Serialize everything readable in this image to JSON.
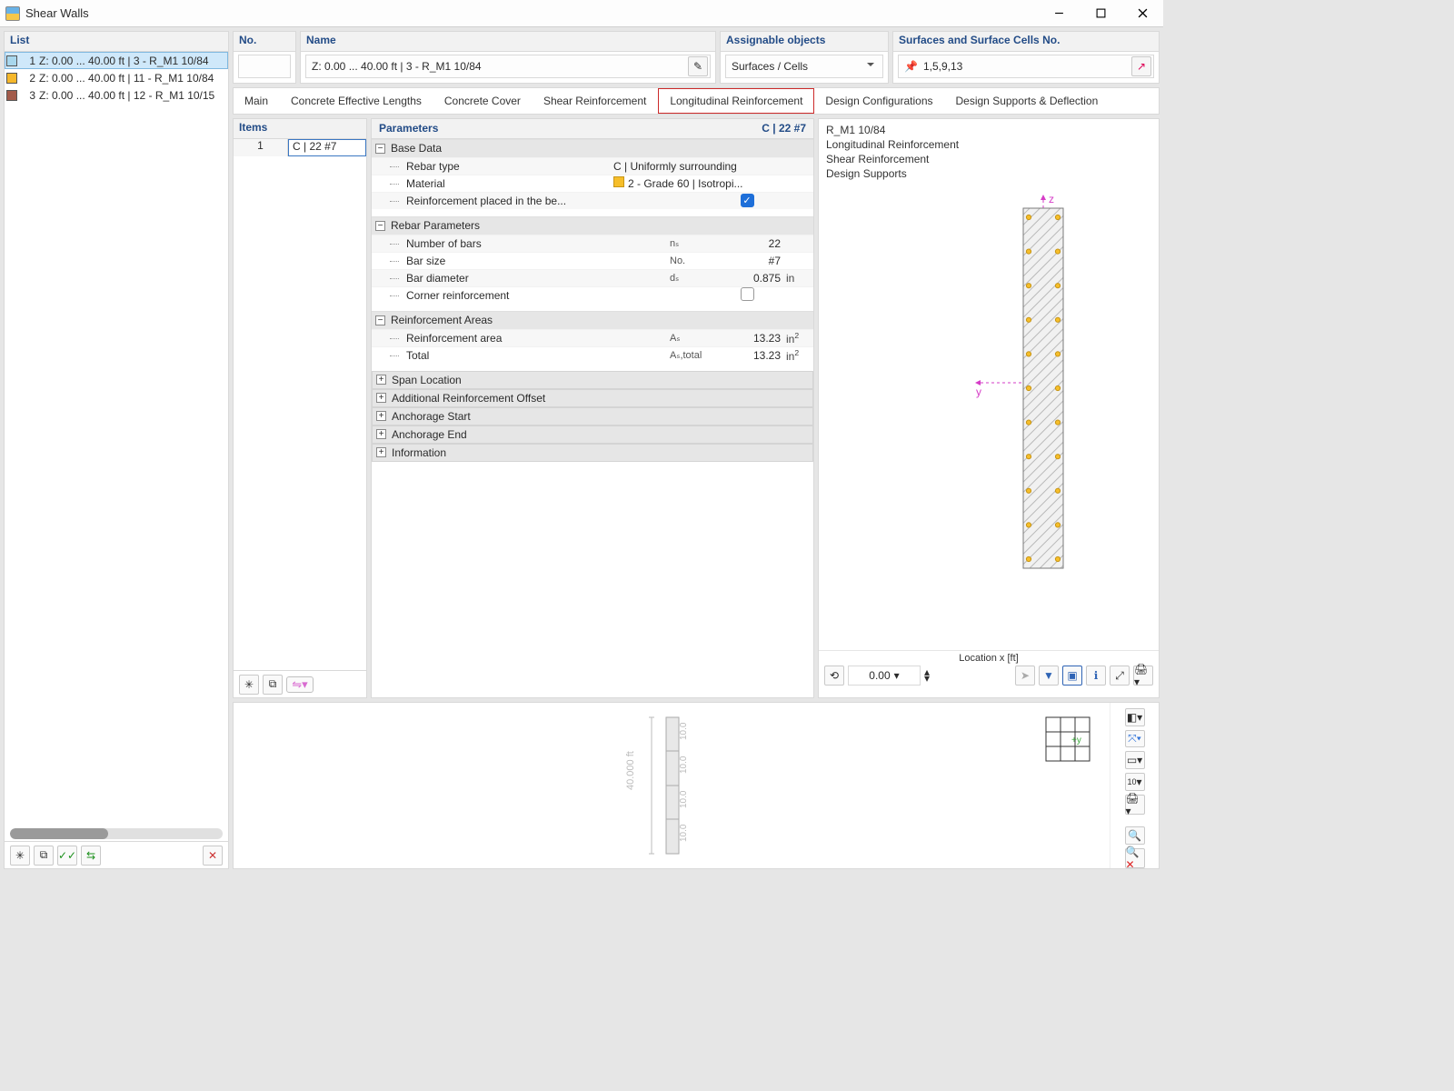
{
  "window": {
    "title": "Shear Walls"
  },
  "sidebar": {
    "header": "List",
    "items": [
      {
        "n": "1",
        "swatch": "#a8d7ed",
        "text": "Z: 0.00 ... 40.00 ft | 3 - R_M1 10/84",
        "selected": true
      },
      {
        "n": "2",
        "swatch": "#f5b72b",
        "text": "Z: 0.00 ... 40.00 ft | 11 - R_M1 10/84",
        "selected": false
      },
      {
        "n": "3",
        "swatch": "#a35b4a",
        "text": "Z: 0.00 ... 40.00 ft | 12 - R_M1 10/15",
        "selected": false
      }
    ]
  },
  "top": {
    "no_label": "No.",
    "no_value": "",
    "name_label": "Name",
    "name_value": "Z: 0.00 ... 40.00  ft | 3 - R_M1 10/84",
    "assign_label": "Assignable objects",
    "assign_value": "Surfaces / Cells",
    "surf_label": "Surfaces and Surface Cells No.",
    "surf_value": "1,5,9,13"
  },
  "tabs": [
    {
      "label": "Main",
      "active": false
    },
    {
      "label": "Concrete Effective Lengths",
      "active": false
    },
    {
      "label": "Concrete Cover",
      "active": false
    },
    {
      "label": "Shear Reinforcement",
      "active": false
    },
    {
      "label": "Longitudinal Reinforcement",
      "active": true
    },
    {
      "label": "Design Configurations",
      "active": false
    },
    {
      "label": "Design Supports & Deflection",
      "active": false
    }
  ],
  "items": {
    "header": "Items",
    "rows": [
      {
        "n": "1",
        "val": "C | 22 #7"
      }
    ]
  },
  "params": {
    "header": "Parameters",
    "header_right": "C | 22 #7",
    "groups": [
      {
        "title": "Base Data",
        "open": true,
        "rows": [
          {
            "label": "Rebar type",
            "sym": "",
            "val": "C | Uniformly surrounding",
            "unit": "",
            "mode": "text"
          },
          {
            "label": "Material",
            "sym": "",
            "val": "2 - Grade 60 | Isotropi...",
            "unit": "",
            "mode": "swatch"
          },
          {
            "label": "Reinforcement placed in the be...",
            "sym": "",
            "val": "",
            "unit": "",
            "mode": "checked"
          }
        ]
      },
      {
        "title": "Rebar Parameters",
        "open": true,
        "rows": [
          {
            "label": "Number of bars",
            "sym": "nₛ",
            "val": "22",
            "unit": ""
          },
          {
            "label": "Bar size",
            "sym": "No.",
            "val": "#7",
            "unit": ""
          },
          {
            "label": "Bar diameter",
            "sym": "dₛ",
            "val": "0.875",
            "unit": "in"
          },
          {
            "label": "Corner reinforcement",
            "sym": "",
            "val": "",
            "unit": "",
            "mode": "unchecked"
          }
        ]
      },
      {
        "title": "Reinforcement Areas",
        "open": true,
        "rows": [
          {
            "label": "Reinforcement area",
            "sym": "Aₛ",
            "val": "13.23",
            "unit": "in²"
          },
          {
            "label": "Total",
            "sym": "Aₛ,total",
            "val": "13.23",
            "unit": "in²"
          }
        ]
      },
      {
        "title": "Span Location",
        "open": false
      },
      {
        "title": "Additional Reinforcement Offset",
        "open": false
      },
      {
        "title": "Anchorage Start",
        "open": false
      },
      {
        "title": "Anchorage End",
        "open": false
      },
      {
        "title": "Information",
        "open": false
      }
    ]
  },
  "viz": {
    "lines": [
      "R_M1 10/84",
      "Longitudinal Reinforcement",
      "Shear Reinforcement",
      "Design Supports"
    ],
    "axis_label": "Location x [ft]",
    "loc_value": "0.00"
  },
  "bottom": {
    "dim_total": "40.000 ft",
    "segment": "10.0"
  }
}
